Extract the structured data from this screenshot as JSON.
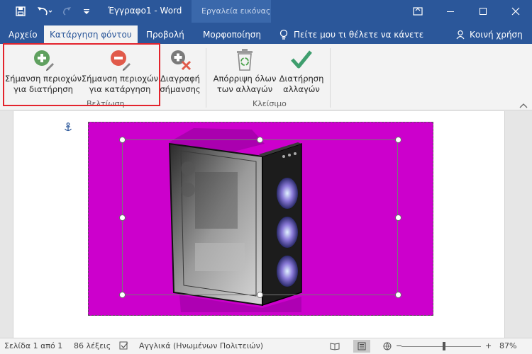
{
  "app": {
    "doc_title": "Έγγραφο1 - Word",
    "context_tab_title": "Εργαλεία εικόνας"
  },
  "tabs": [
    {
      "label": "Αρχείο"
    },
    {
      "label": "Κατάργηση φόντου",
      "active": true
    },
    {
      "label": "Προβολή"
    },
    {
      "label": "Μορφοποίηση"
    }
  ],
  "tellme": {
    "label": "Πείτε μου τι θέλετε να κάνετε"
  },
  "share": {
    "label": "Κοινή χρήση"
  },
  "ribbon": {
    "refine_group": {
      "label": "Βελτίωση",
      "mark_keep": {
        "line1": "Σήμανση περιοχών",
        "line2": "για διατήρηση"
      },
      "mark_remove": {
        "line1": "Σήμανση περιοχών",
        "line2": "για κατάργηση"
      },
      "delete_mark": {
        "line1": "Διαγραφή",
        "line2": "σήμανσης"
      }
    },
    "close_group": {
      "label": "Κλείσιμο",
      "discard": {
        "line1": "Απόρριψη όλων",
        "line2": "των αλλαγών"
      },
      "keep": {
        "line1": "Διατήρηση",
        "line2": "αλλαγών"
      }
    }
  },
  "status": {
    "page": "Σελίδα 1 από 1",
    "words": "86 λέξεις",
    "language": "Αγγλικά (Ηνωμένων Πολιτειών)",
    "zoom": "87%",
    "zoom_minus": "−",
    "zoom_plus": "+"
  },
  "colors": {
    "brand": "#2b579a",
    "removal_overlay": "#cc00cc",
    "highlight": "#e3232c"
  }
}
